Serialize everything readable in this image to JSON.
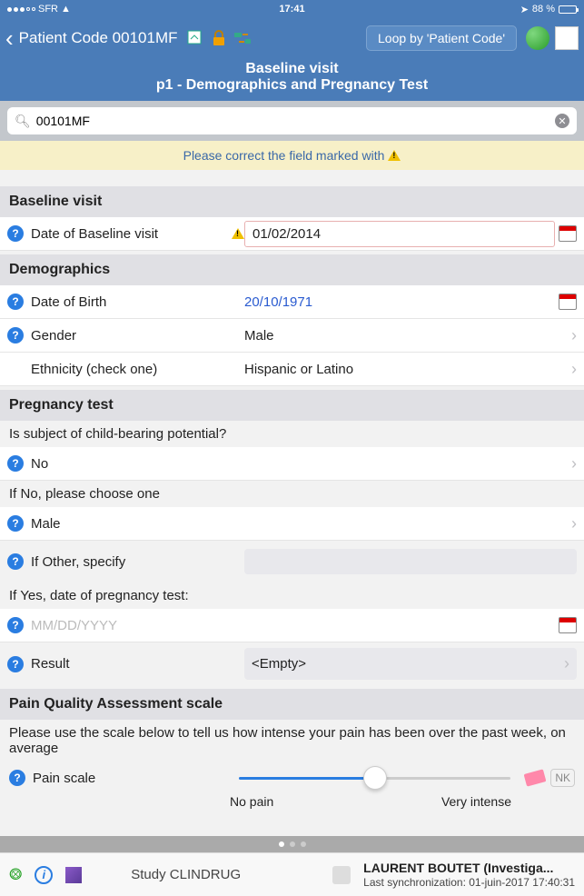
{
  "statusbar": {
    "carrier": "SFR",
    "time": "17:41",
    "battery": "88 %"
  },
  "navbar": {
    "back": "Patient Code 00101MF",
    "loop": "Loop by 'Patient Code'"
  },
  "subheader": {
    "l1": "Baseline visit",
    "l2": "p1 - Demographics and Pregnancy Test"
  },
  "search": {
    "value": "00101MF"
  },
  "warning": {
    "text": "Please correct the field marked with"
  },
  "sections": {
    "baseline": {
      "title": "Baseline visit",
      "date_label": "Date of Baseline visit",
      "date_value": "01/02/2014"
    },
    "demographics": {
      "title": "Demographics",
      "dob_label": "Date of Birth",
      "dob_value": "20/10/1971",
      "gender_label": "Gender",
      "gender_value": "Male",
      "eth_label": "Ethnicity (check one)",
      "eth_value": "Hispanic or Latino"
    },
    "pregnancy": {
      "title": "Pregnancy test",
      "q1": "Is subject of child-bearing potential?",
      "q1_value": "No",
      "q2": "If No, please choose one",
      "q2_value": "Male",
      "q3_label": "If Other, specify",
      "q4": "If Yes, date of pregnancy test:",
      "q4_placeholder": "MM/DD/YYYY",
      "result_label": "Result",
      "result_value": "<Empty>"
    },
    "pain": {
      "title": "Pain Quality Assessment scale",
      "instr": "Please use the scale below to tell us how intense your pain has been over the past week, on average",
      "scale_label": "Pain scale",
      "min": "No pain",
      "max": "Very intense",
      "nk": "NK"
    }
  },
  "footer": {
    "study": "Study CLINDRUG",
    "user": "LAURENT BOUTET (Investiga...",
    "sync": "Last synchronization: 01-juin-2017 17:40:31"
  }
}
